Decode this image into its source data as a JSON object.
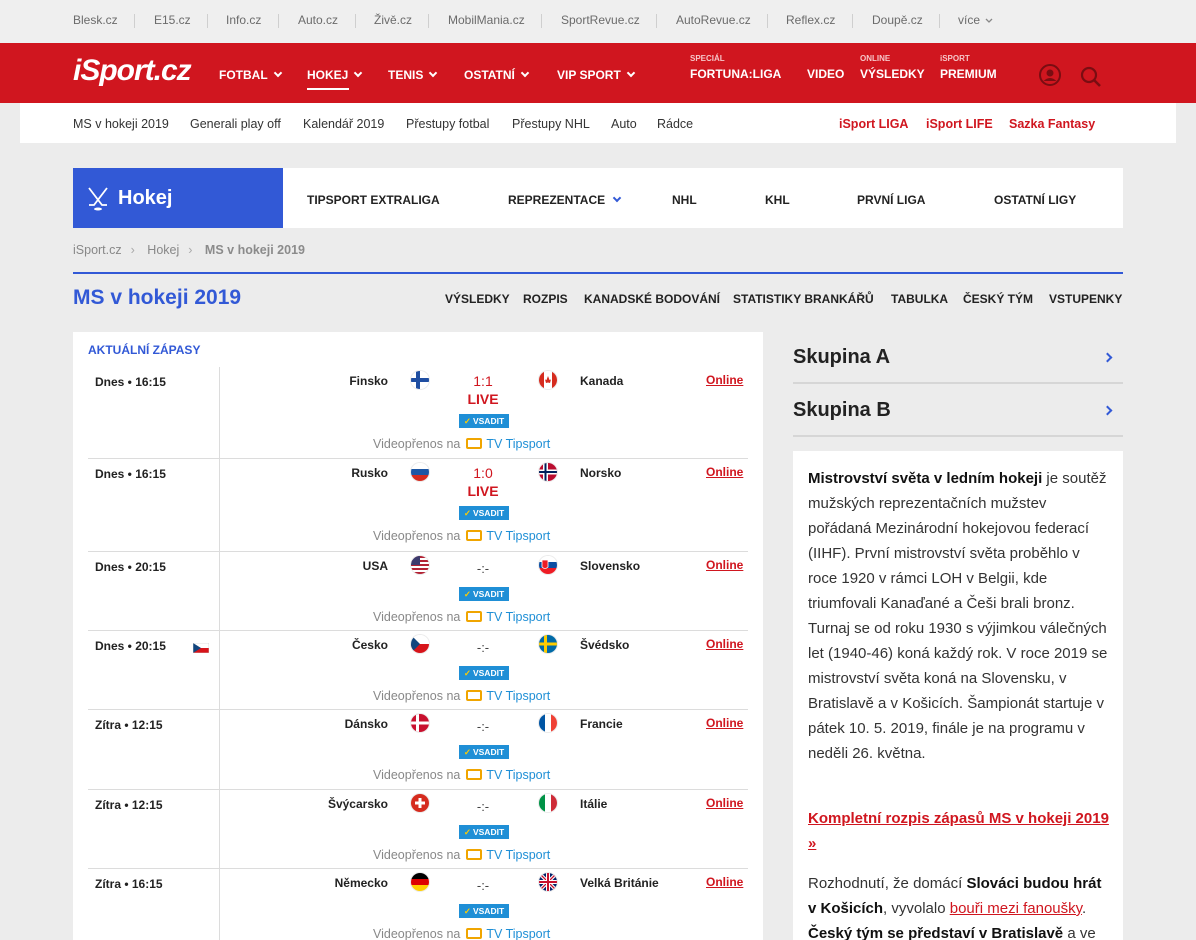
{
  "network_links": [
    "Blesk.cz",
    "E15.cz",
    "Info.cz",
    "Auto.cz",
    "Živě.cz",
    "MobilMania.cz",
    "SportRevue.cz",
    "AutoRevue.cz",
    "Reflex.cz",
    "Doupě.cz",
    "více"
  ],
  "header": {
    "logo": "iSport.cz",
    "nav": [
      "FOTBAL",
      "HOKEJ",
      "TENIS",
      "OSTATNÍ",
      "VIP SPORT"
    ],
    "active_nav": "HOKEJ",
    "promos": [
      {
        "small": "SPECIÁL",
        "big": "FORTUNA:LIGA"
      },
      {
        "small": "",
        "big": "VIDEO"
      },
      {
        "small": "ONLINE",
        "big": "VÝSLEDKY"
      },
      {
        "small": "iSPORT",
        "big": "PREMIUM"
      }
    ],
    "icons": [
      "user-icon",
      "search-icon"
    ]
  },
  "subbar": {
    "links": [
      "MS v hokeji 2019",
      "Generali play off",
      "Kalendář 2019",
      "Přestupy fotbal",
      "Přestupy NHL",
      "Auto",
      "Rádce"
    ],
    "red_links": [
      "iSport LIGA",
      "iSport LIFE",
      "Sazka Fantasy"
    ]
  },
  "section": {
    "brand": "Hokej",
    "brand_icon": "hockey-sticks-icon",
    "tabs": [
      "TIPSPORT EXTRALIGA",
      "REPREZENTACE",
      "NHL",
      "KHL",
      "PRVNÍ LIGA",
      "OSTATNÍ LIGY"
    ]
  },
  "breadcrumb": [
    "iSport.cz",
    "Hokej",
    "MS v hokeji 2019"
  ],
  "page": {
    "title": "MS v hokeji 2019",
    "subnav": [
      "VÝSLEDKY",
      "ROZPIS",
      "KANADSKÉ BODOVÁNÍ",
      "STATISTIKY BRANKÁŘŮ",
      "TABULKA",
      "ČESKÝ TÝM",
      "VSTUPENKY"
    ]
  },
  "matches": {
    "title": "AKTUÁLNÍ ZÁPASY",
    "bet_label": "VSADIT",
    "video_label": "Videopřenos na",
    "video_channel": "TV Tipsport",
    "online_label": "Online",
    "items": [
      {
        "time": "Dnes • 16:15",
        "home": "Finsko",
        "away": "Kanada",
        "score": "1:1",
        "status": "LIVE",
        "home_flag": "finland-flag-icon",
        "away_flag": "canada-flag-icon"
      },
      {
        "time": "Dnes • 16:15",
        "home": "Rusko",
        "away": "Norsko",
        "score": "1:0",
        "status": "LIVE",
        "home_flag": "russia-flag-icon",
        "away_flag": "norway-flag-icon"
      },
      {
        "time": "Dnes • 20:15",
        "home": "USA",
        "away": "Slovensko",
        "score": "-:-",
        "status": "",
        "home_flag": "usa-flag-icon",
        "away_flag": "slovakia-flag-icon"
      },
      {
        "time": "Dnes • 20:15",
        "home": "Česko",
        "away": "Švédsko",
        "score": "-:-",
        "status": "",
        "home_flag": "czech-flag-icon",
        "away_flag": "sweden-flag-icon",
        "marker": "czech-marker-icon"
      },
      {
        "time": "Zítra • 12:15",
        "home": "Dánsko",
        "away": "Francie",
        "score": "-:-",
        "status": "",
        "home_flag": "denmark-flag-icon",
        "away_flag": "france-flag-icon"
      },
      {
        "time": "Zítra • 12:15",
        "home": "Švýcarsko",
        "away": "Itálie",
        "score": "-:-",
        "status": "",
        "home_flag": "switzerland-flag-icon",
        "away_flag": "italy-flag-icon"
      },
      {
        "time": "Zítra • 16:15",
        "home": "Německo",
        "away": "Velká Británie",
        "score": "-:-",
        "status": "",
        "home_flag": "germany-flag-icon",
        "away_flag": "great-britain-flag-icon"
      }
    ]
  },
  "sidebar": {
    "groups": [
      "Skupina A",
      "Skupina B"
    ],
    "info": {
      "p1_bold": "Mistrovství světa v ledním hokeji",
      "p1_text": " je soutěž mužských reprezentačních mužstev pořádaná Mezinárodní hokejovou federací (IIHF). První mistrovství světa proběhlo v roce 1920 v rámci LOH v Belgii, kde triumfovali Kanaďané a Češi brali bronz. Turnaj se od roku 1930 s výjimkou válečných let (1940-46) koná každý rok. V roce 2019 se mistrovství světa koná na Slovensku, v Bratislavě a v Košicích. Šampionát startuje v pátek 10. 5. 2019, finále je na programu v neděli 26. května.",
      "link": "Kompletní rozpis zápasů MS v hokeji 2019 »",
      "p3_a": "Rozhodnutí, že domácí ",
      "p3_b": "Slováci budou hrát v Košicích",
      "p3_c": ", vyvolalo ",
      "p3_link": "bouři mezi fanoušky",
      "p3_d": ". ",
      "p3_e": "Český tým se představí v Bratislavě",
      "p3_f": " a ve"
    }
  }
}
